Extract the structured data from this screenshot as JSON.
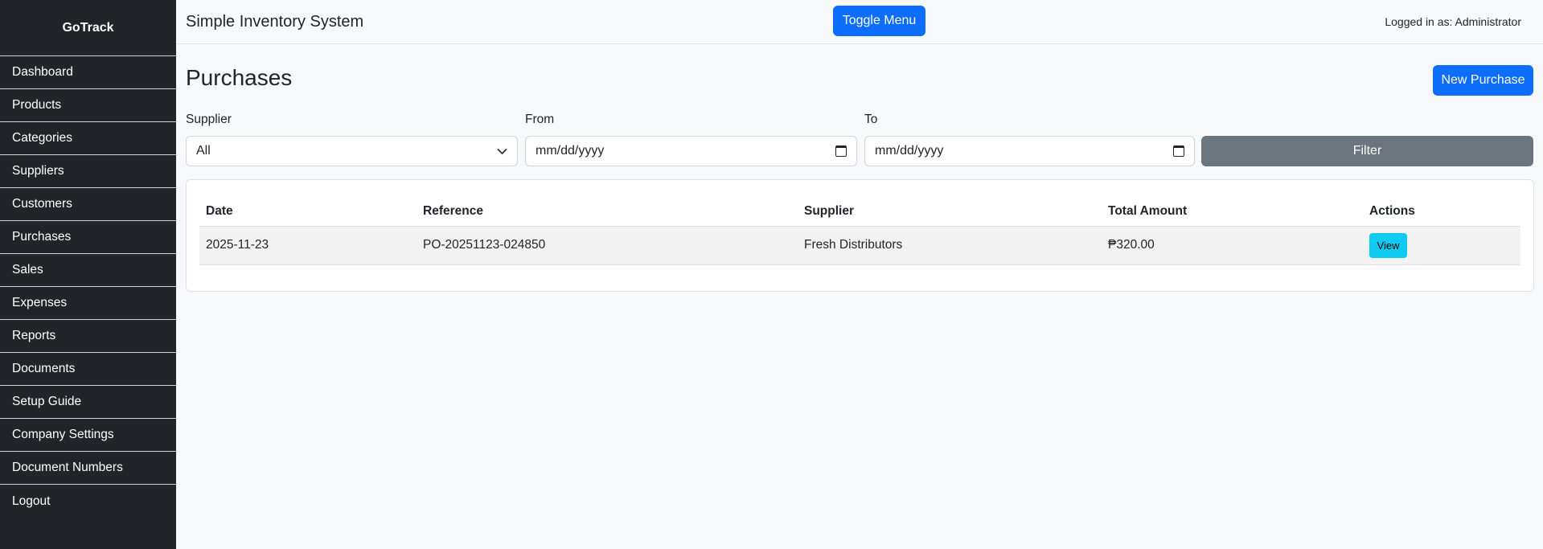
{
  "sidebar": {
    "brand": "GoTrack",
    "items": [
      {
        "label": "Dashboard"
      },
      {
        "label": "Products"
      },
      {
        "label": "Categories"
      },
      {
        "label": "Suppliers"
      },
      {
        "label": "Customers"
      },
      {
        "label": "Purchases"
      },
      {
        "label": "Sales"
      },
      {
        "label": "Expenses"
      },
      {
        "label": "Reports"
      },
      {
        "label": "Documents"
      },
      {
        "label": "Setup Guide"
      },
      {
        "label": "Company Settings"
      },
      {
        "label": "Document Numbers"
      },
      {
        "label": "Logout"
      }
    ]
  },
  "header": {
    "title": "Simple Inventory System",
    "toggle_label": "Toggle Menu",
    "user_text": "Logged in as: Administrator"
  },
  "page": {
    "title": "Purchases",
    "new_button": "New Purchase"
  },
  "filters": {
    "supplier_label": "Supplier",
    "supplier_value": "All",
    "from_label": "From",
    "from_value": "mm/dd/yyyy",
    "to_label": "To",
    "to_value": "mm/dd/yyyy",
    "filter_button": "Filter"
  },
  "table": {
    "columns": [
      "Date",
      "Reference",
      "Supplier",
      "Total Amount",
      "Actions"
    ],
    "rows": [
      {
        "date": "2025-11-23",
        "reference": "PO-20251123-024850",
        "supplier": "Fresh Distributors",
        "total": "₱320.00",
        "action": "View"
      }
    ]
  },
  "colors": {
    "sidebar_bg": "#212529",
    "primary": "#0d6efd",
    "secondary": "#6c757d",
    "info": "#0dcaf0"
  }
}
